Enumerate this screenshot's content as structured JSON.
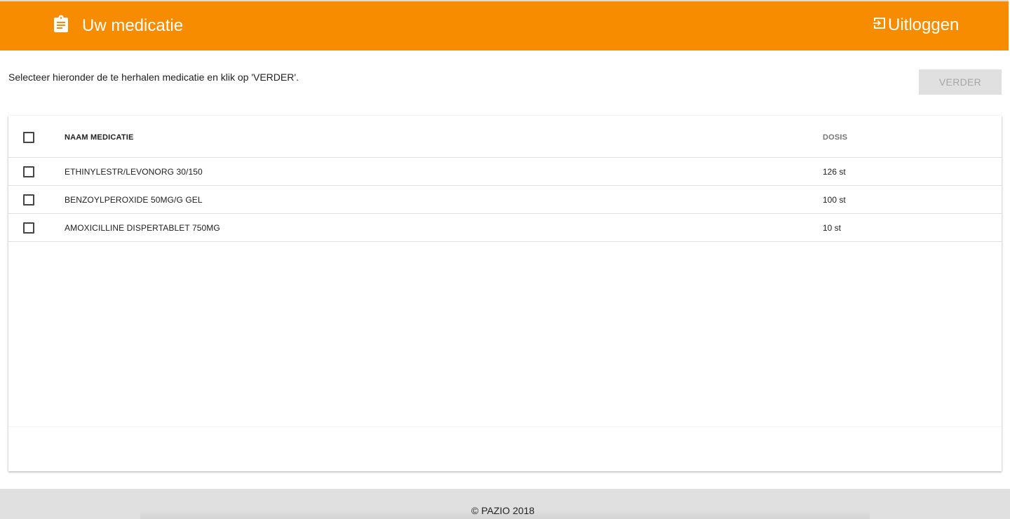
{
  "header": {
    "title": "Uw medicatie",
    "title_icon": "clipboard-icon",
    "logout_label": "Uitloggen",
    "logout_icon": "logout-icon",
    "background_color": "#f88c00"
  },
  "instruction": "Selecteer hieronder de te herhalen medicatie en klik op 'VERDER'.",
  "next_button": {
    "label": "VERDER",
    "state": "disabled"
  },
  "table": {
    "columns": [
      "NAAM MEDICATIE",
      "DOSIS"
    ],
    "rows": [
      {
        "name": "ETHINYLESTR/LEVONORG 30/150",
        "dose": "126 st",
        "checked": false
      },
      {
        "name": "BENZOYLPEROXIDE 50MG/G GEL",
        "dose": "100 st",
        "checked": false
      },
      {
        "name": "AMOXICILLINE DISPERTABLET 750MG",
        "dose": "10 st",
        "checked": false
      }
    ]
  },
  "footer": {
    "copyright": "© PAZIO 2018"
  }
}
